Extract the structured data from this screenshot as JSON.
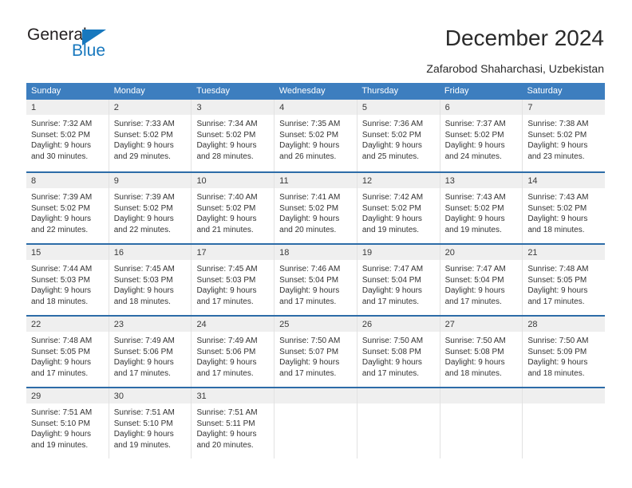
{
  "brand": {
    "name_part1": "General",
    "name_part2": "Blue",
    "accent_color": "#1878be"
  },
  "header": {
    "title": "December 2024",
    "subtitle": "Zafarobod Shaharchasi, Uzbekistan"
  },
  "calendar": {
    "header_bg": "#3d7ebf",
    "row_border_color": "#2d6ca8",
    "daynum_band_bg": "#efefef",
    "day_names": [
      "Sunday",
      "Monday",
      "Tuesday",
      "Wednesday",
      "Thursday",
      "Friday",
      "Saturday"
    ],
    "weeks": [
      [
        {
          "day": "1",
          "l1": "Sunrise: 7:32 AM",
          "l2": "Sunset: 5:02 PM",
          "l3": "Daylight: 9 hours",
          "l4": "and 30 minutes."
        },
        {
          "day": "2",
          "l1": "Sunrise: 7:33 AM",
          "l2": "Sunset: 5:02 PM",
          "l3": "Daylight: 9 hours",
          "l4": "and 29 minutes."
        },
        {
          "day": "3",
          "l1": "Sunrise: 7:34 AM",
          "l2": "Sunset: 5:02 PM",
          "l3": "Daylight: 9 hours",
          "l4": "and 28 minutes."
        },
        {
          "day": "4",
          "l1": "Sunrise: 7:35 AM",
          "l2": "Sunset: 5:02 PM",
          "l3": "Daylight: 9 hours",
          "l4": "and 26 minutes."
        },
        {
          "day": "5",
          "l1": "Sunrise: 7:36 AM",
          "l2": "Sunset: 5:02 PM",
          "l3": "Daylight: 9 hours",
          "l4": "and 25 minutes."
        },
        {
          "day": "6",
          "l1": "Sunrise: 7:37 AM",
          "l2": "Sunset: 5:02 PM",
          "l3": "Daylight: 9 hours",
          "l4": "and 24 minutes."
        },
        {
          "day": "7",
          "l1": "Sunrise: 7:38 AM",
          "l2": "Sunset: 5:02 PM",
          "l3": "Daylight: 9 hours",
          "l4": "and 23 minutes."
        }
      ],
      [
        {
          "day": "8",
          "l1": "Sunrise: 7:39 AM",
          "l2": "Sunset: 5:02 PM",
          "l3": "Daylight: 9 hours",
          "l4": "and 22 minutes."
        },
        {
          "day": "9",
          "l1": "Sunrise: 7:39 AM",
          "l2": "Sunset: 5:02 PM",
          "l3": "Daylight: 9 hours",
          "l4": "and 22 minutes."
        },
        {
          "day": "10",
          "l1": "Sunrise: 7:40 AM",
          "l2": "Sunset: 5:02 PM",
          "l3": "Daylight: 9 hours",
          "l4": "and 21 minutes."
        },
        {
          "day": "11",
          "l1": "Sunrise: 7:41 AM",
          "l2": "Sunset: 5:02 PM",
          "l3": "Daylight: 9 hours",
          "l4": "and 20 minutes."
        },
        {
          "day": "12",
          "l1": "Sunrise: 7:42 AM",
          "l2": "Sunset: 5:02 PM",
          "l3": "Daylight: 9 hours",
          "l4": "and 19 minutes."
        },
        {
          "day": "13",
          "l1": "Sunrise: 7:43 AM",
          "l2": "Sunset: 5:02 PM",
          "l3": "Daylight: 9 hours",
          "l4": "and 19 minutes."
        },
        {
          "day": "14",
          "l1": "Sunrise: 7:43 AM",
          "l2": "Sunset: 5:02 PM",
          "l3": "Daylight: 9 hours",
          "l4": "and 18 minutes."
        }
      ],
      [
        {
          "day": "15",
          "l1": "Sunrise: 7:44 AM",
          "l2": "Sunset: 5:03 PM",
          "l3": "Daylight: 9 hours",
          "l4": "and 18 minutes."
        },
        {
          "day": "16",
          "l1": "Sunrise: 7:45 AM",
          "l2": "Sunset: 5:03 PM",
          "l3": "Daylight: 9 hours",
          "l4": "and 18 minutes."
        },
        {
          "day": "17",
          "l1": "Sunrise: 7:45 AM",
          "l2": "Sunset: 5:03 PM",
          "l3": "Daylight: 9 hours",
          "l4": "and 17 minutes."
        },
        {
          "day": "18",
          "l1": "Sunrise: 7:46 AM",
          "l2": "Sunset: 5:04 PM",
          "l3": "Daylight: 9 hours",
          "l4": "and 17 minutes."
        },
        {
          "day": "19",
          "l1": "Sunrise: 7:47 AM",
          "l2": "Sunset: 5:04 PM",
          "l3": "Daylight: 9 hours",
          "l4": "and 17 minutes."
        },
        {
          "day": "20",
          "l1": "Sunrise: 7:47 AM",
          "l2": "Sunset: 5:04 PM",
          "l3": "Daylight: 9 hours",
          "l4": "and 17 minutes."
        },
        {
          "day": "21",
          "l1": "Sunrise: 7:48 AM",
          "l2": "Sunset: 5:05 PM",
          "l3": "Daylight: 9 hours",
          "l4": "and 17 minutes."
        }
      ],
      [
        {
          "day": "22",
          "l1": "Sunrise: 7:48 AM",
          "l2": "Sunset: 5:05 PM",
          "l3": "Daylight: 9 hours",
          "l4": "and 17 minutes."
        },
        {
          "day": "23",
          "l1": "Sunrise: 7:49 AM",
          "l2": "Sunset: 5:06 PM",
          "l3": "Daylight: 9 hours",
          "l4": "and 17 minutes."
        },
        {
          "day": "24",
          "l1": "Sunrise: 7:49 AM",
          "l2": "Sunset: 5:06 PM",
          "l3": "Daylight: 9 hours",
          "l4": "and 17 minutes."
        },
        {
          "day": "25",
          "l1": "Sunrise: 7:50 AM",
          "l2": "Sunset: 5:07 PM",
          "l3": "Daylight: 9 hours",
          "l4": "and 17 minutes."
        },
        {
          "day": "26",
          "l1": "Sunrise: 7:50 AM",
          "l2": "Sunset: 5:08 PM",
          "l3": "Daylight: 9 hours",
          "l4": "and 17 minutes."
        },
        {
          "day": "27",
          "l1": "Sunrise: 7:50 AM",
          "l2": "Sunset: 5:08 PM",
          "l3": "Daylight: 9 hours",
          "l4": "and 18 minutes."
        },
        {
          "day": "28",
          "l1": "Sunrise: 7:50 AM",
          "l2": "Sunset: 5:09 PM",
          "l3": "Daylight: 9 hours",
          "l4": "and 18 minutes."
        }
      ],
      [
        {
          "day": "29",
          "l1": "Sunrise: 7:51 AM",
          "l2": "Sunset: 5:10 PM",
          "l3": "Daylight: 9 hours",
          "l4": "and 19 minutes."
        },
        {
          "day": "30",
          "l1": "Sunrise: 7:51 AM",
          "l2": "Sunset: 5:10 PM",
          "l3": "Daylight: 9 hours",
          "l4": "and 19 minutes."
        },
        {
          "day": "31",
          "l1": "Sunrise: 7:51 AM",
          "l2": "Sunset: 5:11 PM",
          "l3": "Daylight: 9 hours",
          "l4": "and 20 minutes."
        },
        {
          "day": "",
          "l1": "",
          "l2": "",
          "l3": "",
          "l4": ""
        },
        {
          "day": "",
          "l1": "",
          "l2": "",
          "l3": "",
          "l4": ""
        },
        {
          "day": "",
          "l1": "",
          "l2": "",
          "l3": "",
          "l4": ""
        },
        {
          "day": "",
          "l1": "",
          "l2": "",
          "l3": "",
          "l4": ""
        }
      ]
    ]
  }
}
